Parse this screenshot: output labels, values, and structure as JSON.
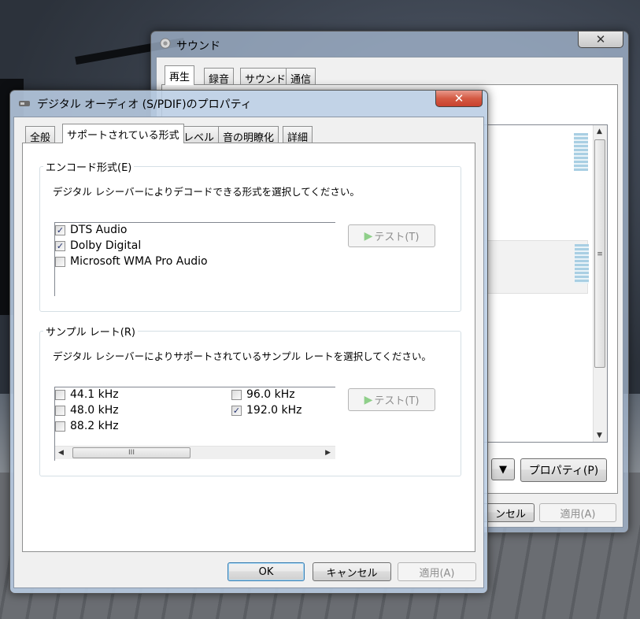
{
  "sound_window": {
    "title": "サウンド",
    "close_label": "✕",
    "tabs": [
      "再生",
      "録音",
      "サウンド",
      "通信"
    ],
    "dropdown_arrow": "▼",
    "properties_label": "プロパティ(P)",
    "cancel_label": "キャンセル",
    "cancel_partial": "ンセル",
    "apply_label": "適用(A)"
  },
  "dialog": {
    "title": "デジタル オーディオ (S/PDIF)のプロパティ",
    "close_label": "✕",
    "tabs": [
      "全般",
      "サポートされている形式",
      "レベル",
      "音の明瞭化",
      "詳細"
    ],
    "encode": {
      "group_label": "エンコード形式(E)",
      "description": "デジタル レシーバーによりデコードできる形式を選択してください。",
      "items": [
        {
          "label": "DTS Audio",
          "checked": true
        },
        {
          "label": "Dolby Digital",
          "checked": true
        },
        {
          "label": "Microsoft WMA Pro Audio",
          "checked": false
        }
      ],
      "test_label": "テスト(T)"
    },
    "sample_rate": {
      "group_label": "サンプル レート(R)",
      "description": "デジタル レシーバーによりサポートされているサンプル レートを選択してください。",
      "items": [
        {
          "label": "44.1 kHz",
          "checked": false
        },
        {
          "label": "48.0 kHz",
          "checked": false
        },
        {
          "label": "88.2 kHz",
          "checked": false
        },
        {
          "label": "96.0 kHz",
          "checked": false
        },
        {
          "label": "192.0 kHz",
          "checked": true
        }
      ],
      "test_label": "テスト(T)",
      "scroll_grip": "III"
    },
    "buttons": {
      "ok": "OK",
      "cancel": "キャンセル",
      "apply": "適用(A)"
    }
  },
  "colors": {
    "close_red": "#c8412e",
    "accent_blue": "#3c7fb1",
    "check_mark": "#22306e"
  }
}
